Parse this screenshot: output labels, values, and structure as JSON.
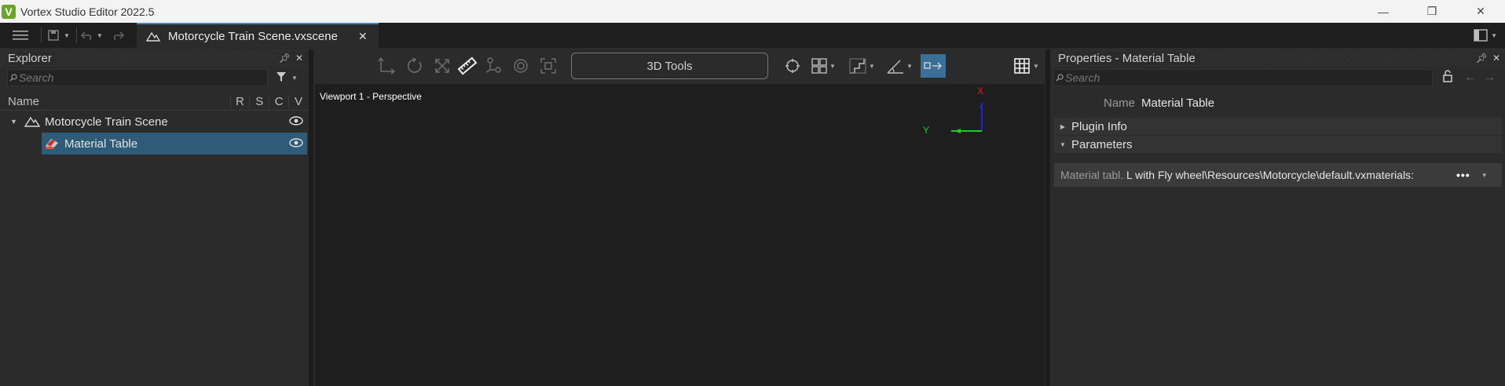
{
  "app": {
    "title": "Vortex Studio Editor 2022.5",
    "logo": "V"
  },
  "window_controls": {
    "minimize": "—",
    "maximize": "❐",
    "close": "✕"
  },
  "tabbar": {
    "document_tab": "Motorcycle Train Scene.vxscene",
    "close": "✕"
  },
  "explorer": {
    "title": "Explorer",
    "search_placeholder": "Search",
    "columns": {
      "name": "Name",
      "r": "R",
      "s": "S",
      "c": "C",
      "v": "V"
    },
    "items": [
      {
        "label": "Motorcycle Train Scene",
        "expanded": true
      },
      {
        "label": "Material Table",
        "selected": true
      }
    ]
  },
  "toolbar": {
    "tools3d_label": "3D Tools"
  },
  "viewport": {
    "label": "Viewport 1 - Perspective",
    "axis_x": "X",
    "axis_y": "Y"
  },
  "properties": {
    "title": "Properties - Material Table",
    "search_placeholder": "Search",
    "name_label": "Name",
    "name_value": "Material Table",
    "sections": [
      "Plugin Info",
      "Parameters"
    ],
    "param_label": "Material tabl...",
    "param_value": ":L with Fly wheel\\Resources\\Motorcycle\\default.vxmaterials",
    "param_more": "•••"
  },
  "colors": {
    "selection": "#2d5b78",
    "accent": "#3c8dbc",
    "active_tool": "#3a6f98"
  }
}
